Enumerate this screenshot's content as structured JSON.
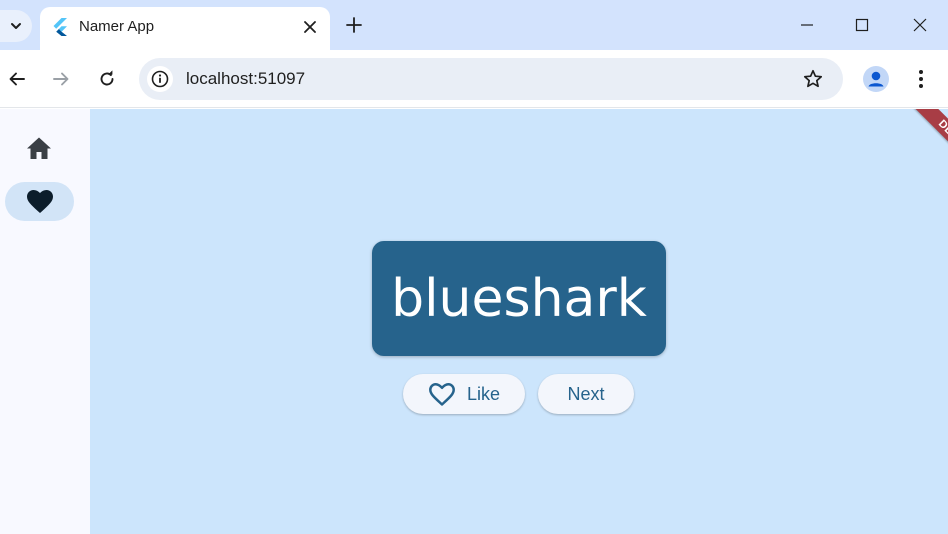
{
  "browser": {
    "tab": {
      "title": "Namer App"
    },
    "address": {
      "url": "localhost:51097"
    }
  },
  "app": {
    "nav": {
      "items": [
        {
          "icon": "home-icon",
          "selected": false
        },
        {
          "icon": "favorite-icon",
          "selected": true
        }
      ]
    },
    "word": "blueshark",
    "buttons": {
      "like_label": "Like",
      "next_label": "Next"
    },
    "debug_banner": "DEBUG"
  },
  "colors": {
    "accent": "#26638c",
    "content_background": "#cce5fc",
    "rail_background": "#f8f9ff",
    "selected_indicator": "#d2e4f7",
    "tabstrip": "#d3e3fd",
    "debug_banner": "#a83d45"
  }
}
